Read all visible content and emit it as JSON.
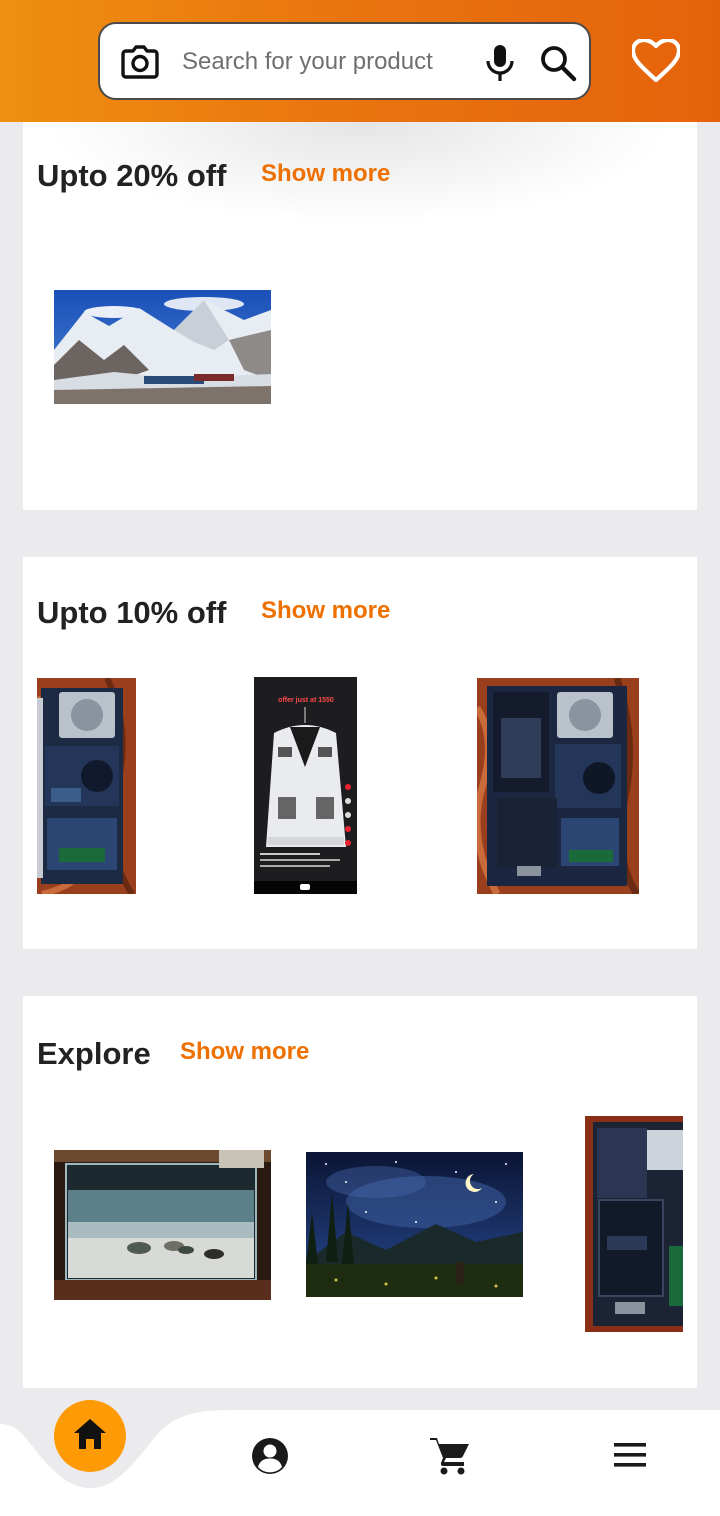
{
  "header": {
    "search_placeholder": "Search for your product"
  },
  "icons": {
    "camera": "camera-icon",
    "mic": "microphone-icon",
    "search": "search-icon",
    "wishlist": "heart-icon",
    "home": "home-icon",
    "account": "account-icon",
    "cart": "cart-icon",
    "menu": "menu-icon"
  },
  "sections": [
    {
      "title": "Upto 20% off",
      "show_more": "Show more",
      "items": [
        {
          "image": "mountain-snow-photo"
        }
      ]
    },
    {
      "title": "Upto 10% off",
      "show_more": "Show more",
      "items": [
        {
          "image": "laptop-internals-photo"
        },
        {
          "image": "white-jacket-photo",
          "overlay_text": "offer just at 1550"
        },
        {
          "image": "laptop-internals-photo"
        }
      ]
    },
    {
      "title": "Explore",
      "show_more": "Show more",
      "items": [
        {
          "image": "aquarium-tank-photo"
        },
        {
          "image": "night-sky-photo"
        },
        {
          "image": "laptop-battery-photo"
        }
      ]
    }
  ],
  "colors": {
    "header_start": "#ef8f10",
    "header_end": "#e5620c",
    "accent": "#ee7000",
    "home_button": "#fe9a06",
    "page_bg": "#ebebee"
  }
}
